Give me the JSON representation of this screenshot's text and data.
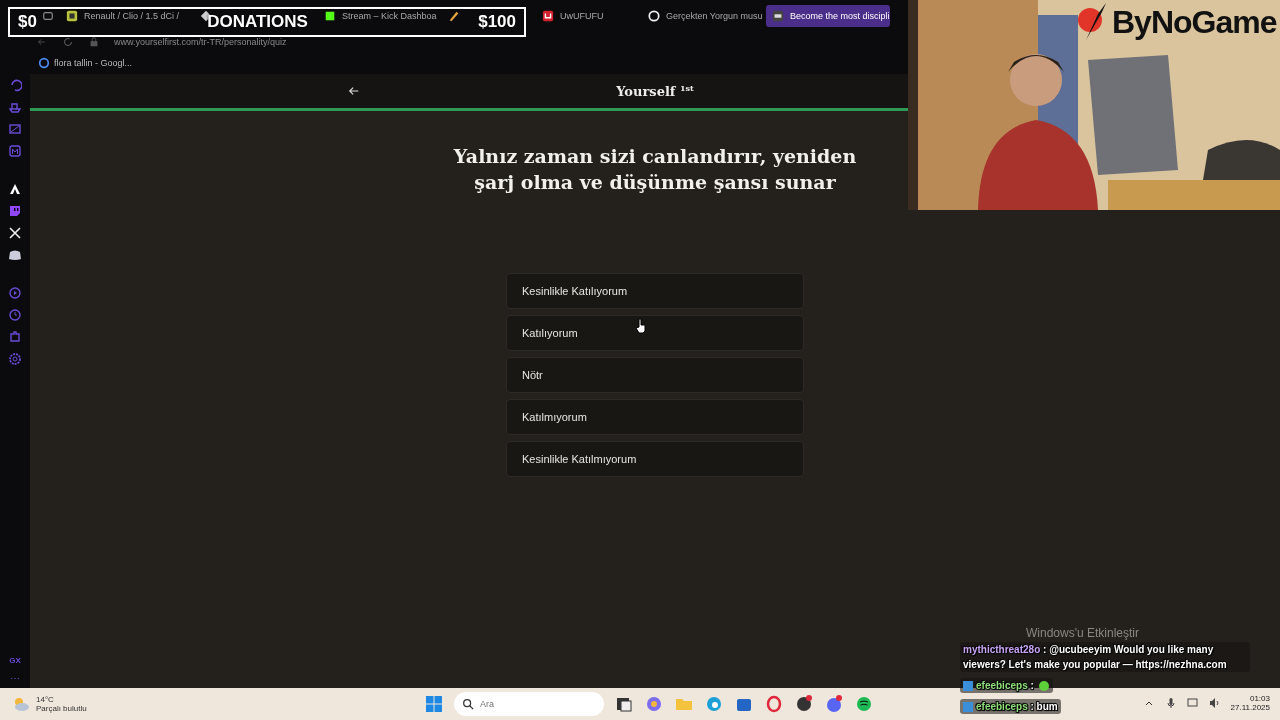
{
  "tabs": [
    {
      "selected": false
    },
    {
      "title": "Renault / Clio / 1.5 dCi /",
      "selected": false
    },
    {
      "selected": false
    },
    {
      "title": "Stream – Kick Dashboa",
      "selected": false
    },
    {
      "selected": false
    },
    {
      "title": "UwUFUFU",
      "selected": false
    },
    {
      "title": "Gerçekten Yorgun musu",
      "selected": false
    },
    {
      "title": "Become the most discipli",
      "selected": true
    }
  ],
  "address": "www.yourselfirst.com/tr-TR/personality/quiz",
  "bookmarks": [
    {
      "label": "flora tallin - Googl..."
    }
  ],
  "sidebar": {
    "footer": "GX",
    "more": "⋯"
  },
  "page": {
    "title": "Yourself $^{1st}$",
    "question": "Yalnız zaman sizi canlandırır, yeniden şarj olma ve düşünme şansı sunar",
    "options": [
      "Kesinlikle Katılıyorum",
      "Katılıyorum",
      "Nötr",
      "Katılmıyorum",
      "Kesinlikle Katılmıyorum"
    ]
  },
  "donations": {
    "min": "$0",
    "title": "DONATIONS",
    "max": "$100"
  },
  "webcam": {
    "kind": "picture",
    "logo": "ByNoGame"
  },
  "activation": "Windows'u Etkinleştir",
  "chat": [
    {
      "user": "mythicthreat28o",
      "color": "#c9a4f5",
      "message": ": @ucubeeyim Would you like many viewers? Let's make you popular — https://nezhna.com",
      "emote": false
    },
    {
      "user": "efeebiceps",
      "color": "#8fe07a",
      "message": ":",
      "emote": true
    },
    {
      "user": "efeebiceps",
      "color": "#8fe07a",
      "message": ": bum",
      "emote": false
    }
  ],
  "taskbar": {
    "temperature": "14°C",
    "weather": "Parçalı bulutlu",
    "search_placeholder": "Ara",
    "time": "01:03",
    "date": "27.11.2025"
  }
}
